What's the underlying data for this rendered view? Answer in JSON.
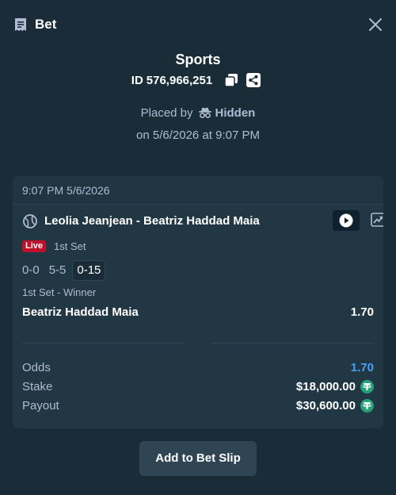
{
  "header": {
    "title": "Bet"
  },
  "bet": {
    "sport": "Sports",
    "id_label": "ID",
    "id_value": "576,966,251",
    "placed_by_label": "Placed by",
    "placed_by_user": "Hidden",
    "placed_on": "on 5/6/2026 at 9:07 PM"
  },
  "card": {
    "time": "9:07 PM 5/6/2026",
    "match": "Leolia Jeanjean - Beatriz Haddad Maia",
    "live_badge": "Live",
    "set_status": "1st Set",
    "scores": [
      "0-0",
      "5-5",
      "0-15"
    ],
    "market": "1st Set - Winner",
    "selection": "Beatriz Haddad Maia",
    "selection_odds": "1.70"
  },
  "summary": {
    "odds_label": "Odds",
    "odds_value": "1.70",
    "stake_label": "Stake",
    "stake_value": "$18,000.00",
    "payout_label": "Payout",
    "payout_value": "$30,600.00"
  },
  "actions": {
    "add_to_slip": "Add to Bet Slip"
  },
  "colors": {
    "background": "#1a2c38",
    "card": "#213743",
    "live": "#c0112a",
    "odds_accent": "#4a9ff5",
    "coin": "#26a17b"
  }
}
